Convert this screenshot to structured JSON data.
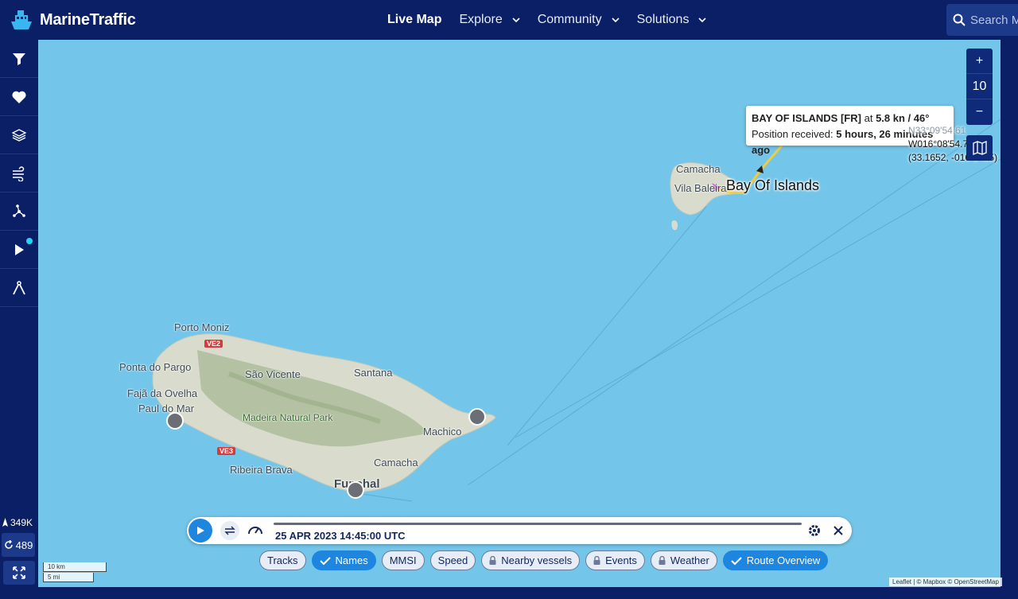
{
  "header": {
    "brand": "MarineTraffic",
    "nav": [
      {
        "label": "Live Map",
        "active": true,
        "dropdown": false
      },
      {
        "label": "Explore",
        "active": false,
        "dropdown": true
      },
      {
        "label": "Community",
        "active": false,
        "dropdown": true
      },
      {
        "label": "Solutions",
        "active": false,
        "dropdown": true
      }
    ],
    "search_placeholder": "Search M"
  },
  "sidebar": {
    "icons": [
      "filter-icon",
      "heart-icon",
      "layers-icon",
      "wind-icon",
      "network-icon",
      "play-icon",
      "measure-icon"
    ],
    "vessel_count": "349K",
    "refresh_count": "489"
  },
  "map": {
    "place_labels": [
      "Porto Moniz",
      "Ponta do Pargo",
      "São Vicente",
      "Santana",
      "Fajã da Ovelha",
      "Paul do Mar",
      "Madeira Natural Park",
      "Machico",
      "Ribeira Brava",
      "Camacha",
      "Funchal",
      "Camacha",
      "Vila Baleira"
    ],
    "road_badges": [
      "VE2",
      "VE3"
    ],
    "vessel_name": "Bay Of Islands",
    "tooltip": {
      "vessel": "BAY OF ISLANDS [FR]",
      "at": "at",
      "speed_course": "5.8 kn / 46°",
      "position_label": "Position received:",
      "position_time": "5 hours, 26 minutes ago"
    },
    "coordinates": {
      "lat_dms": "N33°09'54.61",
      "lon_dms": "W016°08'54.70",
      "decimal": "(33.1652, -016.1485)"
    },
    "zoom_level": "10",
    "scale": {
      "km": "10 km",
      "mi": "5 mi"
    },
    "attribution": "Leaflet | © Mapbox © OpenStreetMap",
    "colors": {
      "sea": "#73c6ea",
      "land": "#d9dccd",
      "track": "#f2cc3b",
      "header": "#0b1f66",
      "accent": "#1f86e0"
    }
  },
  "player": {
    "timestamp": "25 APR 2023 14:45:00 UTC",
    "chips": [
      {
        "label": "Tracks",
        "on": false,
        "locked": false
      },
      {
        "label": "Names",
        "on": true,
        "locked": false
      },
      {
        "label": "MMSI",
        "on": false,
        "locked": false
      },
      {
        "label": "Speed",
        "on": false,
        "locked": false
      },
      {
        "label": "Nearby vessels",
        "on": false,
        "locked": true
      },
      {
        "label": "Events",
        "on": false,
        "locked": true
      },
      {
        "label": "Weather",
        "on": false,
        "locked": true
      },
      {
        "label": "Route Overview",
        "on": true,
        "locked": false
      }
    ]
  }
}
